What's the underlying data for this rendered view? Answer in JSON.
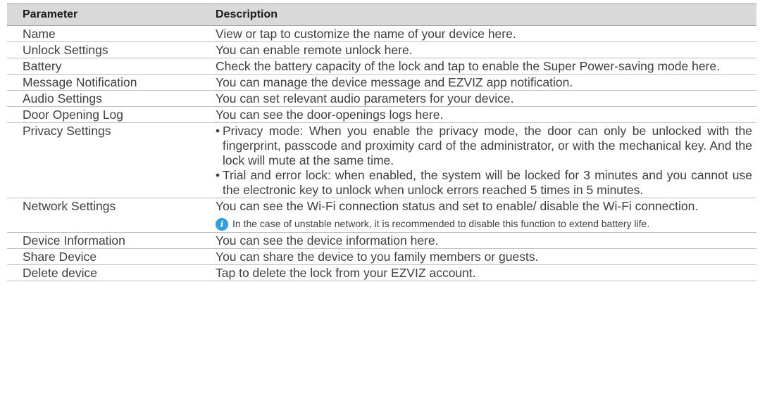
{
  "header": {
    "col1": "Parameter",
    "col2": "Description"
  },
  "rows": [
    {
      "param": "Name",
      "desc": "View or tap to customize the name of your device here."
    },
    {
      "param": "Unlock Settings",
      "desc": "You can enable remote unlock here."
    },
    {
      "param": "Battery",
      "desc": "Check the battery capacity of the lock and tap to enable the Super Power-saving mode here."
    },
    {
      "param": "Message Notification",
      "desc": "You can manage the device message and EZVIZ app notification."
    },
    {
      "param": "Audio Settings",
      "desc": "You can set relevant audio parameters for your device."
    },
    {
      "param": "Door Opening Log",
      "desc": "You can see the door-openings logs here."
    },
    {
      "param": "Privacy Settings",
      "bullets": [
        "Privacy mode: When you enable the privacy mode, the door can only be unlocked with the fingerprint, passcode and proximity card of the administrator, or with the mechanical key. And the lock will mute at the same time.",
        "Trial and error lock: when enabled, the system will be locked for 3 minutes and you cannot use the electronic key to unlock when unlock errors reached 5 times in 5 minutes."
      ]
    },
    {
      "param": "Network Settings",
      "desc": "You can see the Wi-Fi connection status and set to enable/ disable the Wi-Fi connection.",
      "note": "In the case of unstable network, it is recommended to disable this function to extend battery life."
    },
    {
      "param": "Device Information",
      "desc": "You can see the device information here."
    },
    {
      "param": "Share Device",
      "desc": "You can share the device to you family members or guests."
    },
    {
      "param": "Delete device",
      "desc": "Tap to delete the lock from your EZVIZ account."
    }
  ],
  "bullet_char": "•",
  "info_icon": {
    "name": "info-icon",
    "glyph": "i",
    "color": "#2f9fe0"
  }
}
